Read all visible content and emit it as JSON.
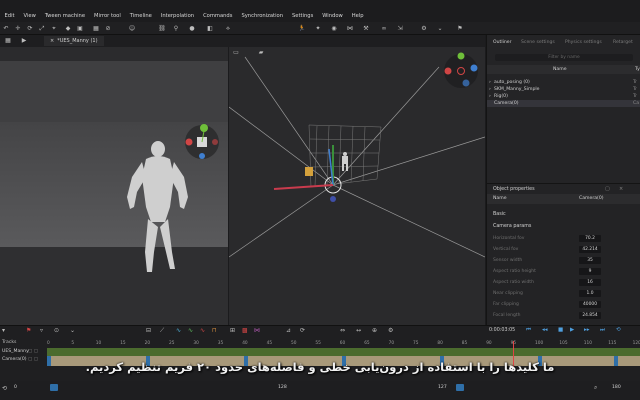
{
  "menu": [
    "Edit",
    "View",
    "Tween machine",
    "Mirror tool",
    "Timeline",
    "Interpolation",
    "Commands",
    "Synchronization",
    "Settings",
    "Window",
    "Help"
  ],
  "tab": {
    "file": "*UES_Manny (1)"
  },
  "right_panel": {
    "tabs": [
      "Outliner",
      "Scene settings",
      "Physics settings",
      "Retarget"
    ],
    "filter_placeholder": "Filter by name",
    "column_name": "Name",
    "column_type": "Ty",
    "outliner_items": [
      {
        "label": "auto_posing (0)",
        "type": "Tr"
      },
      {
        "label": "SKM_Manny_Simple",
        "type": "Tr"
      },
      {
        "label": "Rig(0)",
        "type": "Tr"
      },
      {
        "label": "Camera(0)",
        "type": "Ca"
      }
    ]
  },
  "properties": {
    "title": "Object properties",
    "name_label": "Name",
    "name_value": "Camera(0)",
    "section_basic": "Basic",
    "section_camera": "Camera params",
    "rows": [
      {
        "label": "Horizontal fov",
        "value": "70.2"
      },
      {
        "label": "Vertical fov",
        "value": "42.214"
      },
      {
        "label": "Sensor width",
        "value": "35"
      },
      {
        "label": "Aspect ratio height",
        "value": "9"
      },
      {
        "label": "Aspect ratio width",
        "value": "16"
      },
      {
        "label": "Near clipping",
        "value": "1.0"
      },
      {
        "label": "Far clipping",
        "value": "40000"
      },
      {
        "label": "Focal length",
        "value": "24.854"
      }
    ]
  },
  "timeline": {
    "timecode": "0:00:03:05",
    "tracks": [
      "Tracks",
      "UES_Manny",
      "Camera(0)"
    ],
    "ticks": [
      "0",
      "5",
      "10",
      "15",
      "20",
      "25",
      "30",
      "35",
      "40",
      "45",
      "50",
      "55",
      "60",
      "65",
      "70",
      "75",
      "80",
      "85",
      "90",
      "95",
      "100",
      "105",
      "110",
      "115",
      "120",
      "125"
    ],
    "frame_start": "0",
    "frame_mid": "128",
    "frame_current": "127",
    "frame_end": "180",
    "zoom": "180"
  },
  "subtitle": "ما کلیدها را با استفاده از درون‌یابی خطی و فاصله‌های حدود ۲۰ فریم تنظیم کردیم.",
  "colors": {
    "accent_blue": "#2f6fa8",
    "anim_track": "#4b6b2e",
    "cam_track": "#a8997a",
    "playhead": "#e04545"
  }
}
